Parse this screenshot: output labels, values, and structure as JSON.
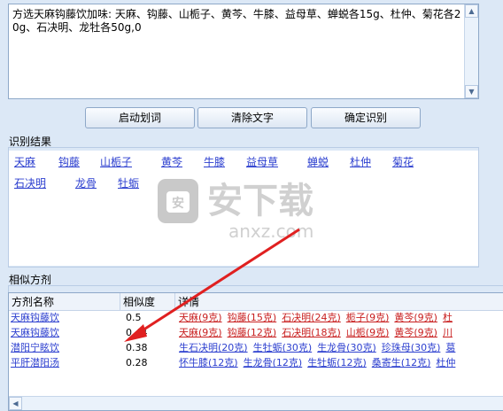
{
  "input": {
    "text": "方选天麻钩藤饮加味: 天麻、钩藤、山栀子、黄芩、牛膝、益母草、蝉蜕各15g、杜仲、菊花各20g、石决明、龙牡各50g,0"
  },
  "buttons": {
    "start": "启动划词",
    "clear": "清除文字",
    "confirm": "确定识别"
  },
  "results": {
    "label": "识别结果",
    "herbs": [
      "天麻",
      "钩藤",
      "山栀子",
      "黄芩",
      "牛膝",
      "益母草",
      "蝉蜕",
      "杜仲",
      "菊花",
      "石决明",
      "龙骨",
      "牡蛎"
    ]
  },
  "similar": {
    "label": "相似方剂",
    "columns": [
      "方剂名称",
      "相似度",
      "详情"
    ],
    "rows": [
      {
        "name": "天麻钩藤饮",
        "sim": "0.5",
        "details": [
          "天麻(9克)",
          "钩藤(15克)",
          "石决明(24克)",
          "栀子(9克)",
          "黄芩(9克)",
          "杜"
        ],
        "color": "#c81e1e"
      },
      {
        "name": "天麻钩藤饮",
        "sim": "0.44",
        "details": [
          "天麻(9克)",
          "钩藤(12克)",
          "石决明(18克)",
          "山栀(9克)",
          "黄芩(9克)",
          "川"
        ],
        "color": "#c81e1e"
      },
      {
        "name": "潜阳宁眩饮",
        "sim": "0.38",
        "details": [
          "生石决明(20克)",
          "生牡蛎(30克)",
          "生龙骨(30克)",
          "珍珠母(30克)",
          "葛"
        ],
        "color": "#2c3fcf"
      },
      {
        "name": "平肝潜阳汤",
        "sim": "0.28",
        "details": [
          "怀牛膝(12克)",
          "生龙骨(12克)",
          "生牡蛎(12克)",
          "桑寄生(12克)",
          "杜仲"
        ],
        "color": "#2c3fcf"
      }
    ]
  },
  "watermark": {
    "cn": "安下载",
    "en": "anxz.com"
  },
  "colors": {
    "link": "#2c3fcf",
    "match": "#c81e1e",
    "annotation": "#e02020"
  }
}
